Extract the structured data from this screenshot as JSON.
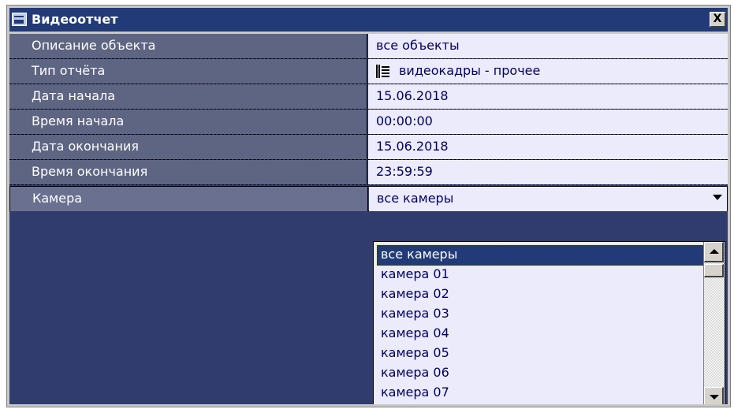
{
  "window": {
    "title": "Видеоотчет",
    "close_label": "X"
  },
  "properties": [
    {
      "label": "Описание объекта",
      "value": "все объекты"
    },
    {
      "label": "Тип отчёта",
      "value": "видеокадры - прочее",
      "icon": "report-type-icon"
    },
    {
      "label": "Дата начала",
      "value": "15.06.2018"
    },
    {
      "label": "Время начала",
      "value": "00:00:00"
    },
    {
      "label": "Дата окончания",
      "value": "15.06.2018"
    },
    {
      "label": "Время окончания",
      "value": "23:59:59"
    },
    {
      "label": "Камера",
      "value": "все камеры"
    }
  ],
  "camera_dropdown": {
    "selected": "все камеры",
    "options": [
      "все камеры",
      "камера 01",
      "камера 02",
      "камера 03",
      "камера 04",
      "камера 05",
      "камера 06",
      "камера 07"
    ]
  },
  "colors": {
    "title_bar": "#223a78",
    "label_bg": "#5e6582",
    "value_bg": "#ecebfc",
    "body_bg": "#313c6e",
    "selection": "#223a78"
  }
}
